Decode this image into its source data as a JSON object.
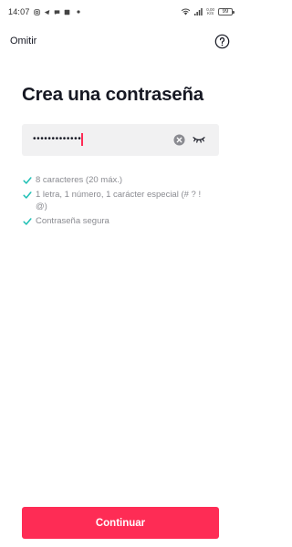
{
  "status_bar": {
    "time": "14:07",
    "net_speed_value": "0,00",
    "net_speed_unit": "K/S",
    "battery": "99"
  },
  "nav": {
    "skip_label": "Omitir",
    "help_icon": "help-circle-icon"
  },
  "main": {
    "title": "Crea una contraseña",
    "password": {
      "value": "•••••••••••••",
      "clear_icon": "clear-icon",
      "visibility_icon": "eye-closed-icon"
    },
    "requirements": [
      {
        "label": "8 caracteres (20 máx.)",
        "met": true
      },
      {
        "label": "1 letra, 1 número, 1 carácter especial (# ? ! @)",
        "met": true
      },
      {
        "label": "Contraseña segura",
        "met": true
      }
    ]
  },
  "footer": {
    "continue_label": "Continuar"
  },
  "colors": {
    "accent": "#fe2c55",
    "check": "#20c0b5",
    "field_bg": "#f1f1f2",
    "text": "#161823",
    "muted_text": "#8a8b91"
  }
}
